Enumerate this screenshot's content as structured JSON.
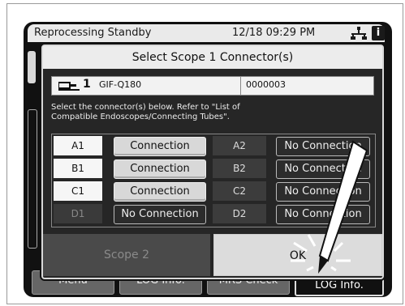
{
  "status_bar": {
    "title": "Reprocessing Standby",
    "datetime": "12/18 09:29 PM"
  },
  "background_tabs": {
    "menu": "Menu",
    "log_info": "LOG Info.",
    "mrs_check": "MRS Check",
    "log_info_right": "LOG Info."
  },
  "dialog": {
    "title": "Select Scope 1 Connector(s)",
    "scope": {
      "number": "1",
      "model": "GIF-Q180",
      "serial": "0000003"
    },
    "instruction_line1": "Select the connector(s) below. Refer to \"List of",
    "instruction_line2": "Compatible Endoscopes/Connecting Tubes\".",
    "connectors": [
      {
        "left_id": "A1",
        "left_state": "Connection",
        "right_id": "A2",
        "right_state": "No Connection"
      },
      {
        "left_id": "B1",
        "left_state": "Connection",
        "right_id": "B2",
        "right_state": "No Connection"
      },
      {
        "left_id": "C1",
        "left_state": "Connection",
        "right_id": "C2",
        "right_state": "No Connection"
      },
      {
        "left_id": "D1",
        "left_state": "No Connection",
        "right_id": "D2",
        "right_state": "No Connection"
      }
    ],
    "scope2_label": "Scope 2",
    "ok_label": "OK"
  },
  "colors": {
    "selected_button": "#d8d8d8",
    "unselected_button": "#2c2c2c",
    "dialog_bg": "#262626"
  }
}
